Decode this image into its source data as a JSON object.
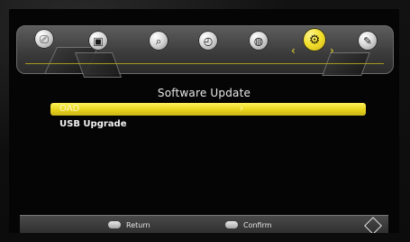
{
  "screen": {
    "title": "Software Update"
  },
  "menu": {
    "items": [
      {
        "label": "OAD",
        "arrow": "›",
        "selected": true
      },
      {
        "label": "USB Upgrade",
        "arrow": "",
        "selected": false
      }
    ]
  },
  "footer": {
    "return_label": "Return",
    "confirm_label": "Confirm"
  },
  "topbar": {
    "icons": [
      {
        "name": "info-screen-icon",
        "glyph": "⎚",
        "active": false
      },
      {
        "name": "media-icon",
        "glyph": "▣",
        "active": false
      },
      {
        "name": "search-icon",
        "glyph": "⌕",
        "active": false
      },
      {
        "name": "time-icon",
        "glyph": "◴",
        "active": false
      },
      {
        "name": "globe-icon",
        "glyph": "◍",
        "active": false
      },
      {
        "name": "settings-gear-icon",
        "glyph": "⚙",
        "active": true
      },
      {
        "name": "tools-icon",
        "glyph": "✎",
        "active": false
      }
    ],
    "active_left_chevron": "‹",
    "active_right_chevron": "›"
  },
  "colors": {
    "accent_yellow": "#f3df2a",
    "topbar_gray": "#3a3a3a",
    "background": "#050505"
  }
}
